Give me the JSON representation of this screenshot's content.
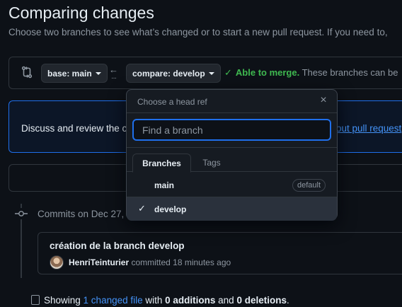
{
  "header": {
    "title": "Comparing changes",
    "subtitle": "Choose two branches to see what’s changed or to start a new pull request. If you need to,"
  },
  "range": {
    "base_label": "base: main",
    "compare_label": "compare: develop",
    "merge_check": "✓",
    "merge_status": "Able to merge.",
    "merge_rest": "These branches can be"
  },
  "discuss": {
    "text": "Discuss and review the c",
    "link": "out pull request"
  },
  "commits": {
    "heading": "Commits on Dec 27,",
    "items": [
      {
        "message": "création de la branch develop",
        "author": "HenriTeinturier",
        "meta": " committed 18 minutes ago"
      }
    ]
  },
  "summary": {
    "prefix": "Showing ",
    "link": "1 changed file",
    "mid": " with ",
    "additions": "0 additions",
    "and": " and ",
    "deletions": "0 deletions",
    "end": "."
  },
  "dropdown": {
    "header": "Choose a head ref",
    "close_symbol": "×",
    "search_placeholder": "Find a branch",
    "tabs": [
      {
        "label": "Branches",
        "active": true
      },
      {
        "label": "Tags",
        "active": false
      }
    ],
    "items": [
      {
        "name": "main",
        "badge": "default",
        "selected": false
      },
      {
        "name": "develop",
        "badge": "",
        "selected": true,
        "check": "✓"
      }
    ]
  },
  "colors": {
    "accent": "#1f6feb",
    "success": "#3fb950",
    "link": "#4493f8",
    "background": "#0d1117"
  }
}
